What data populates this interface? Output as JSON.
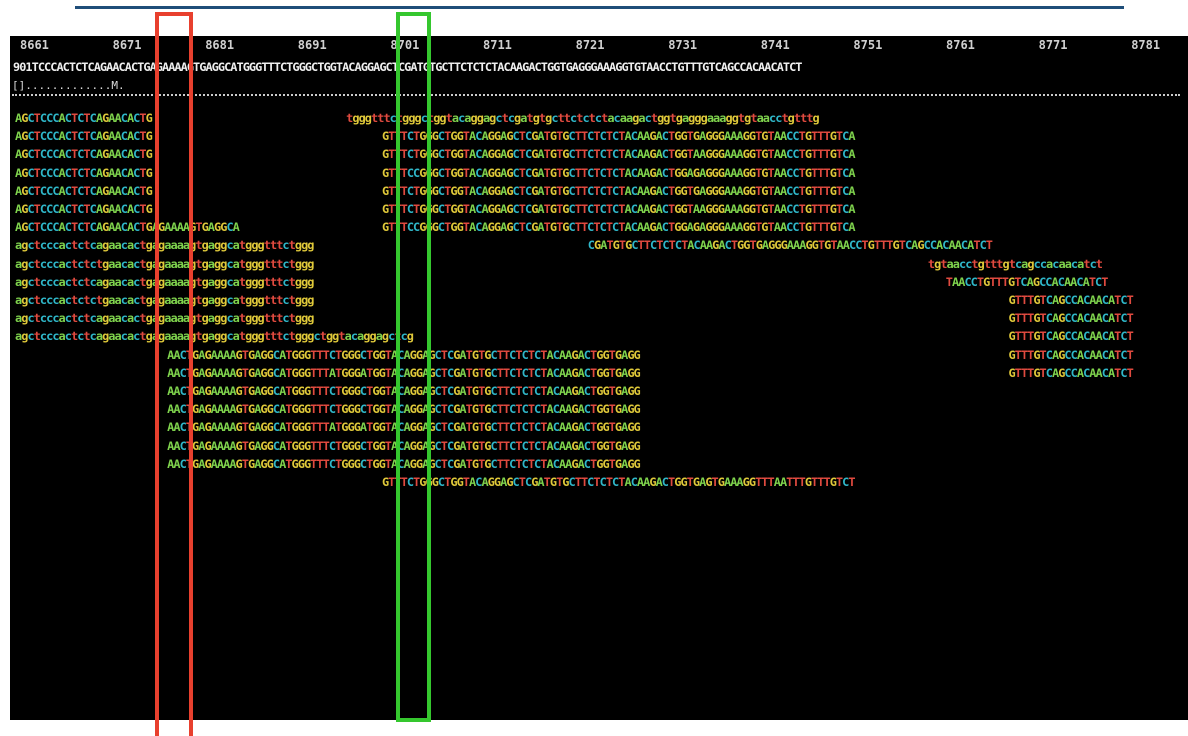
{
  "ruler": {
    "ticks": [
      "8661",
      "8671",
      "8681",
      "8691",
      "8701",
      "8711",
      "8721",
      "8731",
      "8741",
      "8751",
      "8761",
      "8771",
      "8781"
    ]
  },
  "consensus": "901TCCCACTCTCAGAACACTGAGAAAAGTGAGGCATGGGTTTCTGGGCTGGTACAGGAGCTCGATGTGCTTCTCTCTACAAGACTGGTGAGGGAAAGGTGTAACCTGTTTGTCAGCCACAACATCT",
  "marker_line": "[].............M.",
  "reads": [
    {
      "offset": 0,
      "seq": "AGCTCCCACTCTCAGAACACTG"
    },
    {
      "offset": 0,
      "seq": "AGCTCCCACTCTCAGAACACTG"
    },
    {
      "offset": 0,
      "seq": "AGCTCCCACTCTCAGAACACTG"
    },
    {
      "offset": 0,
      "seq": "AGCTCCCACTCTCAGAACACTG"
    },
    {
      "offset": 0,
      "seq": "AGCTCCCACTCTCAGAACACTG"
    },
    {
      "offset": 0,
      "seq": "AGCTCCCACTCTCAGAACACTG"
    },
    {
      "offset": 0,
      "seq": "AGCTCCCACTCTCAGAACACTGAGAAAAGTGAGGCA"
    },
    {
      "offset": 0,
      "seq": "agctcccactctcagaacactgagaaaagtgaggcatgggtttctggg"
    },
    {
      "offset": 0,
      "seq": "agctcccactctctgaacactgagaaaagtgaggcatgggtttctggg"
    },
    {
      "offset": 0,
      "seq": "agctcccactctcagaacactgagaaaagtgaggcatgggtttctggg"
    },
    {
      "offset": 0,
      "seq": "agctcccactctctgaacactgagaaaagtgaggcatgggtttctggg"
    },
    {
      "offset": 0,
      "seq": "agctcccactctcagaacactgagaaaagtgaggcatgggtttctggg"
    },
    {
      "offset": 0,
      "seq": "agctcccactctcagaacactgagaaaagtgaggcatgggtttctgggctggtacaggagctcg"
    },
    {
      "offset": 17,
      "seq": "AACTGAGAAAAGTGAGGCATGGGTTTCTGGGCTGGTACAGGAGCTCGATGTGCTTCTCTCTACAAGACTGGTGAGG"
    },
    {
      "offset": 17,
      "seq": "AACTGAGAAAAGTGAGGCATGGGTTTATGGGATGGTACAGGAGCTCGATGTGCTTCTCTCTACAAGACTGGTGAGG"
    },
    {
      "offset": 17,
      "seq": "AACTGAGAAAAGTGAGGCATGGGTTTCTGGGCTGGTACAGGAGCTCGATGTGCTTCTCTCTACAAGACTGGTGAGG"
    },
    {
      "offset": 17,
      "seq": "AACTGAGAAAAGTGAGGCATGGGTTTCTGGGCTGGTACAGGAGCTCGATGTGCTTCTCTCTACAAGACTGGTGAGG"
    },
    {
      "offset": 17,
      "seq": "AACTGAGAAAAGTGAGGCATGGGTTTATGGGATGGTACAGGAGCTCGATGTGCTTCTCTCTACAAGACTGGTGAGG"
    },
    {
      "offset": 17,
      "seq": "AACTGAGAAAAGTGAGGCATGGGTTTCTGGGCTGGTACAGGAGCTCGATGTGCTTCTCTCTACAAGACTGGTGAGG"
    },
    {
      "offset": 17,
      "seq": "AACTGAGAAAAGTGAGGCATGGGTTTCTGGGCTGGTACAGGAGCTCGATGTGCTTCTCTCTACAAGACTGGTGAGG"
    },
    {
      "offset": 41,
      "seq": "GTTTCTGGGCTGGTACAGGAGCTCGATGTGCTTCTCTCTACAAGACTGGTGAGTGAAAGGTTTAATTTGTTTGTCT"
    }
  ],
  "right_reads": [
    {
      "row": 0,
      "offset": 37,
      "seq": "tgggtttctgggctggtacaggagctcgatgtgcttctctctacaagactggtgagggaaaggtgtaacctgtttg"
    },
    {
      "row": 1,
      "offset": 41,
      "seq": "GTTTCTGGGCTGGTACAGGAGCTCGATGTGCTTCTCTCTACAAGACTGGTGAGGGAAAGGTGTAACCTGTTTGTCA"
    },
    {
      "row": 2,
      "offset": 41,
      "seq": "GTTTCTGGGCTGGTACAGGAGCTCGATGTGCTTCTCTCTACAAGACTGGTAAGGGAAAGGTGTAACCTGTTTGTCA"
    },
    {
      "row": 3,
      "offset": 41,
      "seq": "GTTTCCGGGCTGGTACAGGAGCTCGATGTGCTTCTCTCTACAAGACTGGAGAGGGAAAGGTGTAACCTGTTTGTCA"
    },
    {
      "row": 4,
      "offset": 41,
      "seq": "GTTTCTGGGCTGGTACAGGAGCTCGATGTGCTTCTCTCTACAAGACTGGTGAGGGAAAGGTGTAACCTGTTTGTCA"
    },
    {
      "row": 5,
      "offset": 41,
      "seq": "GTTTCTGGGCTGGTACAGGAGCTCGATGTGCTTCTCTCTACAAGACTGGTAAGGGAAAGGTGTAACCTGTTTGTCA"
    },
    {
      "row": 6,
      "offset": 41,
      "seq": "GTTTCCGGGCTGGTACAGGAGCTCGATGTGCTTCTCTCTACAAGACTGGAGAGGGAAAGGTGTAACCTGTTTGTCA"
    },
    {
      "row": 7,
      "offset": 64,
      "seq": "CGATGTGCTTCTCTCTACAAGACTGGTGAGGGAAAGGTGTAACCTGTTTGTCAGCCACAACATCT"
    },
    {
      "row": 8,
      "offset": 102,
      "seq": "tgtaacctgtttgtcagccacaacatct"
    },
    {
      "row": 9,
      "offset": 104,
      "seq": "TAACCTGTTTGTCAGCCACAACATCT"
    },
    {
      "row": 10,
      "offset": 111,
      "seq": "GTTTGTCAGCCACAACATCT"
    },
    {
      "row": 11,
      "offset": 111,
      "seq": "GTTTGTCAGCCACAACATCT"
    },
    {
      "row": 12,
      "offset": 111,
      "seq": "GTTTGTCAGCCACAACATCT"
    },
    {
      "row": 13,
      "offset": 111,
      "seq": "GTTTGTCAGCCACAACATCT"
    },
    {
      "row": 14,
      "offset": 111,
      "seq": "GTTTGTCAGCCACAACATCT"
    }
  ],
  "highlight_boxes": [
    {
      "name": "red-box",
      "color": "#e8402e"
    },
    {
      "name": "green-box",
      "color": "#35c72e"
    }
  ]
}
